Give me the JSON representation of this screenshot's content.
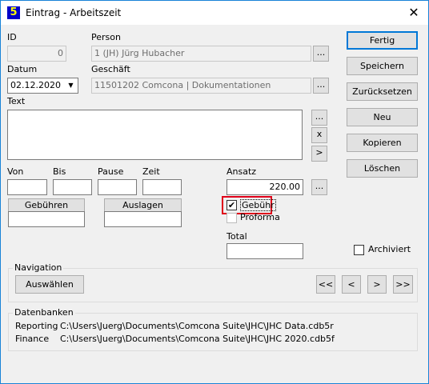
{
  "window": {
    "title": "Eintrag - Arbeitszeit",
    "app_icon_glyph": "5",
    "close_glyph": "✕"
  },
  "fields": {
    "id_label": "ID",
    "id_value": "0",
    "person_label": "Person",
    "person_value": "1 (JH) Jürg Hubacher",
    "datum_label": "Datum",
    "datum_value": "02.12.2020",
    "geschaeft_label": "Geschäft",
    "geschaeft_value": "11501202  Comcona | Dokumentationen",
    "text_label": "Text",
    "text_value": "",
    "von_label": "Von",
    "bis_label": "Bis",
    "pause_label": "Pause",
    "zeit_label": "Zeit",
    "ansatz_label": "Ansatz",
    "ansatz_value": "220.00",
    "total_label": "Total",
    "total_value": ""
  },
  "small_buttons": {
    "ellipsis": "...",
    "clear": "x",
    "next": ">"
  },
  "buttons": {
    "gebuehren": "Gebühren",
    "auslagen": "Auslagen"
  },
  "checkboxes": {
    "gebuehr_label": "Gebühr",
    "gebuehr_checked": true,
    "proforma_label": "Proforma",
    "proforma_checked": false,
    "archiviert_label": "Archiviert",
    "archiviert_checked": false
  },
  "actions": {
    "fertig": "Fertig",
    "speichern": "Speichern",
    "zuruecksetzen": "Zurücksetzen",
    "neu": "Neu",
    "kopieren": "Kopieren",
    "loeschen": "Löschen"
  },
  "navigation": {
    "title": "Navigation",
    "auswaehlen": "Auswählen",
    "first": "<<",
    "prev": "<",
    "next": ">",
    "last": ">>"
  },
  "datenbanken": {
    "title": "Datenbanken",
    "rows": [
      {
        "label": "Reporting",
        "path": "C:\\Users\\Juerg\\Documents\\Comcona Suite\\JHC\\JHC Data.cdb5r"
      },
      {
        "label": "Finance",
        "path": "C:\\Users\\Juerg\\Documents\\Comcona Suite\\JHC\\JHC 2020.cdb5f"
      }
    ]
  },
  "colors": {
    "accent": "#0078d7",
    "highlight": "#e0001a",
    "icon_bg": "#0000c8",
    "icon_fg": "#ffff00"
  }
}
